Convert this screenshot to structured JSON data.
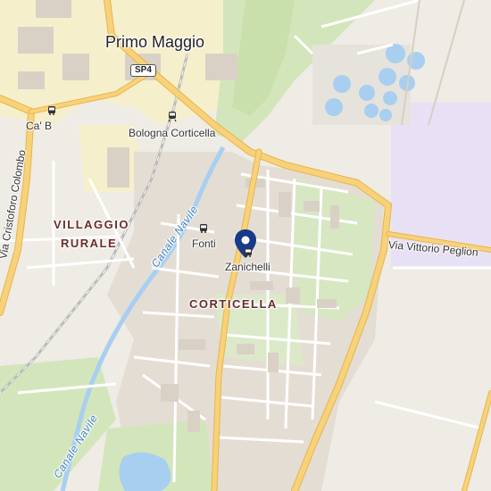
{
  "map": {
    "places": {
      "primo_maggio": "Primo Maggio",
      "villaggio_1": "VILLAGGIO",
      "villaggio_2": "RURALE",
      "corticella": "CORTICELLA",
      "ca_b": "Ca' B"
    },
    "stations": {
      "bologna_corticella": "Bologna Corticella",
      "fonti": "Fonti",
      "zanichelli": "Zanichelli"
    },
    "roads": {
      "sp4": "SP4",
      "via_cristoforo_colombo": "Via Cristoforo Colombo",
      "via_vittorio_peglion": "Via Vittorio Peglion"
    },
    "waterways": {
      "canale_naville_upper": "Canale Navile",
      "canale_naville_lower": "Canale Navile"
    },
    "icons": {
      "marker": "map-pin-icon",
      "train": "train-station-icon",
      "bus": "bus-stop-icon"
    },
    "colors": {
      "background": "#efebe5",
      "urban": "#e6dfd7",
      "park": "#cfe3b4",
      "water": "#a8cff0",
      "industrial": "#e8e1f5",
      "yellow_zone": "#f6efcc",
      "major_road": "#f7d27a",
      "major_road_casing": "#e8b54a",
      "minor_road": "#ffffff",
      "marker": "#173a8a"
    }
  }
}
